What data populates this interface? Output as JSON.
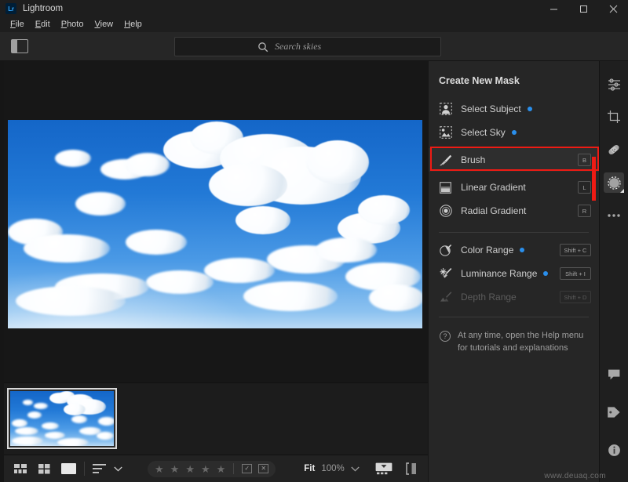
{
  "window": {
    "app_title": "Lightroom",
    "logo_text": "Lr",
    "minimize_label": "Minimize",
    "maximize_label": "Maximize",
    "close_label": "Close"
  },
  "menu": [
    {
      "label": "File",
      "accel": "F"
    },
    {
      "label": "Edit",
      "accel": "E"
    },
    {
      "label": "Photo",
      "accel": "P"
    },
    {
      "label": "View",
      "accel": "V"
    },
    {
      "label": "Help",
      "accel": "H"
    }
  ],
  "toolbar": {
    "panel_toggle_name": "Show/Hide Left Panel",
    "search_placeholder": "Search skies",
    "search_value": "",
    "search_icon": "search-icon",
    "filter_icon": "filter-icon",
    "notifications_icon": "bell-icon",
    "share_icon": "share-icon",
    "help_icon": "help-icon",
    "cloud_icon": "cloud-icon"
  },
  "panel": {
    "title": "Create New Mask",
    "items": [
      {
        "label": "Select Subject",
        "icon": "select-subject-icon",
        "dot": true,
        "shortcut": "",
        "disabled": false,
        "highlight": false
      },
      {
        "label": "Select Sky",
        "icon": "select-sky-icon",
        "dot": true,
        "shortcut": "",
        "disabled": false,
        "highlight": false
      },
      {
        "label": "Brush",
        "icon": "brush-icon",
        "dot": false,
        "shortcut": "B",
        "disabled": false,
        "highlight": true
      },
      {
        "label": "Linear Gradient",
        "icon": "linear-gradient-icon",
        "dot": false,
        "shortcut": "L",
        "disabled": false,
        "highlight": false
      },
      {
        "label": "Radial Gradient",
        "icon": "radial-gradient-icon",
        "dot": false,
        "shortcut": "R",
        "disabled": false,
        "highlight": false
      },
      {
        "label": "Color Range",
        "icon": "color-range-icon",
        "dot": true,
        "shortcut": "Shift + C",
        "disabled": false,
        "highlight": false
      },
      {
        "label": "Luminance Range",
        "icon": "luminance-range-icon",
        "dot": true,
        "shortcut": "Shift + I",
        "disabled": false,
        "highlight": false
      },
      {
        "label": "Depth Range",
        "icon": "depth-range-icon",
        "dot": false,
        "shortcut": "Shift + D",
        "disabled": true,
        "highlight": false
      }
    ],
    "help_line1": "At any time, open the Help menu",
    "help_line2": "for tutorials and explanations",
    "accent_blue": "#2a8fec",
    "highlight_outline": "#ee1b14"
  },
  "rail": {
    "top_items": [
      {
        "name": "edit-icon",
        "active": false
      },
      {
        "name": "crop-icon",
        "active": false
      },
      {
        "name": "healing-icon",
        "active": false
      },
      {
        "name": "masking-icon",
        "active": true
      },
      {
        "name": "more-icon",
        "active": false
      }
    ],
    "bottom_items": [
      {
        "name": "comments-icon",
        "active": false
      },
      {
        "name": "keywords-icon",
        "active": false
      },
      {
        "name": "info-icon",
        "active": false
      }
    ]
  },
  "bottombar": {
    "grid_view_icon": "grid-view-icon",
    "square_grid_icon": "square-grid-icon",
    "detail_view_icon": "detail-view-icon",
    "sort_icon": "sort-icon",
    "sort_chevron_icon": "chevron-down-icon",
    "stars": 5,
    "star_glyph": "★",
    "flag_pick_icon": "flag-pick-icon",
    "flag_reject_icon": "flag-reject-icon",
    "fit_label": "Fit",
    "zoom_label": "100%",
    "zoom_chevron_icon": "chevron-down-icon",
    "filmstrip_toggle_icon": "filmstrip-toggle-icon",
    "compare_icon": "before-after-icon"
  },
  "photo": {
    "alt": "Blue sky with white cumulus clouds",
    "thumbnail_selected": true
  },
  "watermark": "www.deuaq.com"
}
